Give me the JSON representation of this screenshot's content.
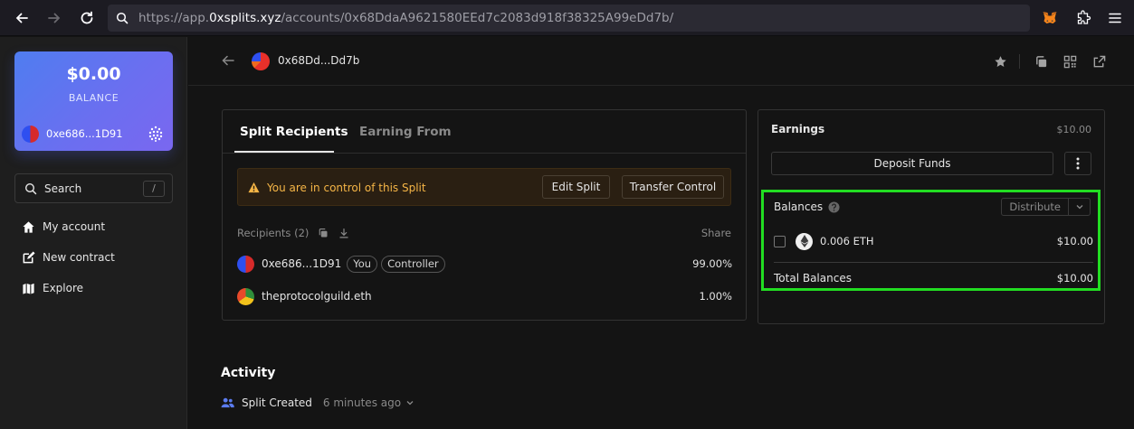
{
  "browser": {
    "url_prefix": "https://app.",
    "url_domain": "0xsplits.xyz",
    "url_path": "/accounts/0x68DdaA9621580EEd7c2083d918f38325A99eDd7b/"
  },
  "sidebar": {
    "balance_amount": "$0.00",
    "balance_label": "BALANCE",
    "account_address": "0xe686...1D91",
    "search_label": "Search",
    "search_shortcut": "/",
    "nav": [
      {
        "label": "My account",
        "icon": "home-icon"
      },
      {
        "label": "New contract",
        "icon": "edit-icon"
      },
      {
        "label": "Explore",
        "icon": "map-icon"
      }
    ]
  },
  "header": {
    "address": "0x68Dd...Dd7b"
  },
  "recipients_panel": {
    "tabs": [
      "Split Recipients",
      "Earning From"
    ],
    "warning_text": "You are in control of this Split",
    "edit_button": "Edit Split",
    "transfer_button": "Transfer Control",
    "recipients_header": "Recipients (2)",
    "share_header": "Share",
    "recipients": [
      {
        "name": "0xe686...1D91",
        "badges": [
          "You",
          "Controller"
        ],
        "share": "99.00%"
      },
      {
        "name": "theprotocolguild.eth",
        "badges": [],
        "share": "1.00%"
      }
    ]
  },
  "earnings": {
    "title": "Earnings",
    "total": "$10.00",
    "deposit_button": "Deposit Funds",
    "balances_title": "Balances",
    "distribute_label": "Distribute",
    "tokens": [
      {
        "amount": "0.006 ETH",
        "usd": "$10.00"
      }
    ],
    "total_label": "Total Balances",
    "total_value": "$10.00"
  },
  "activity": {
    "title": "Activity",
    "event_label": "Split Created",
    "event_time": "6 minutes ago"
  },
  "colors": {
    "accent": "#5b7cf0",
    "warning": "#f5b546",
    "highlight": "#22dd22"
  }
}
